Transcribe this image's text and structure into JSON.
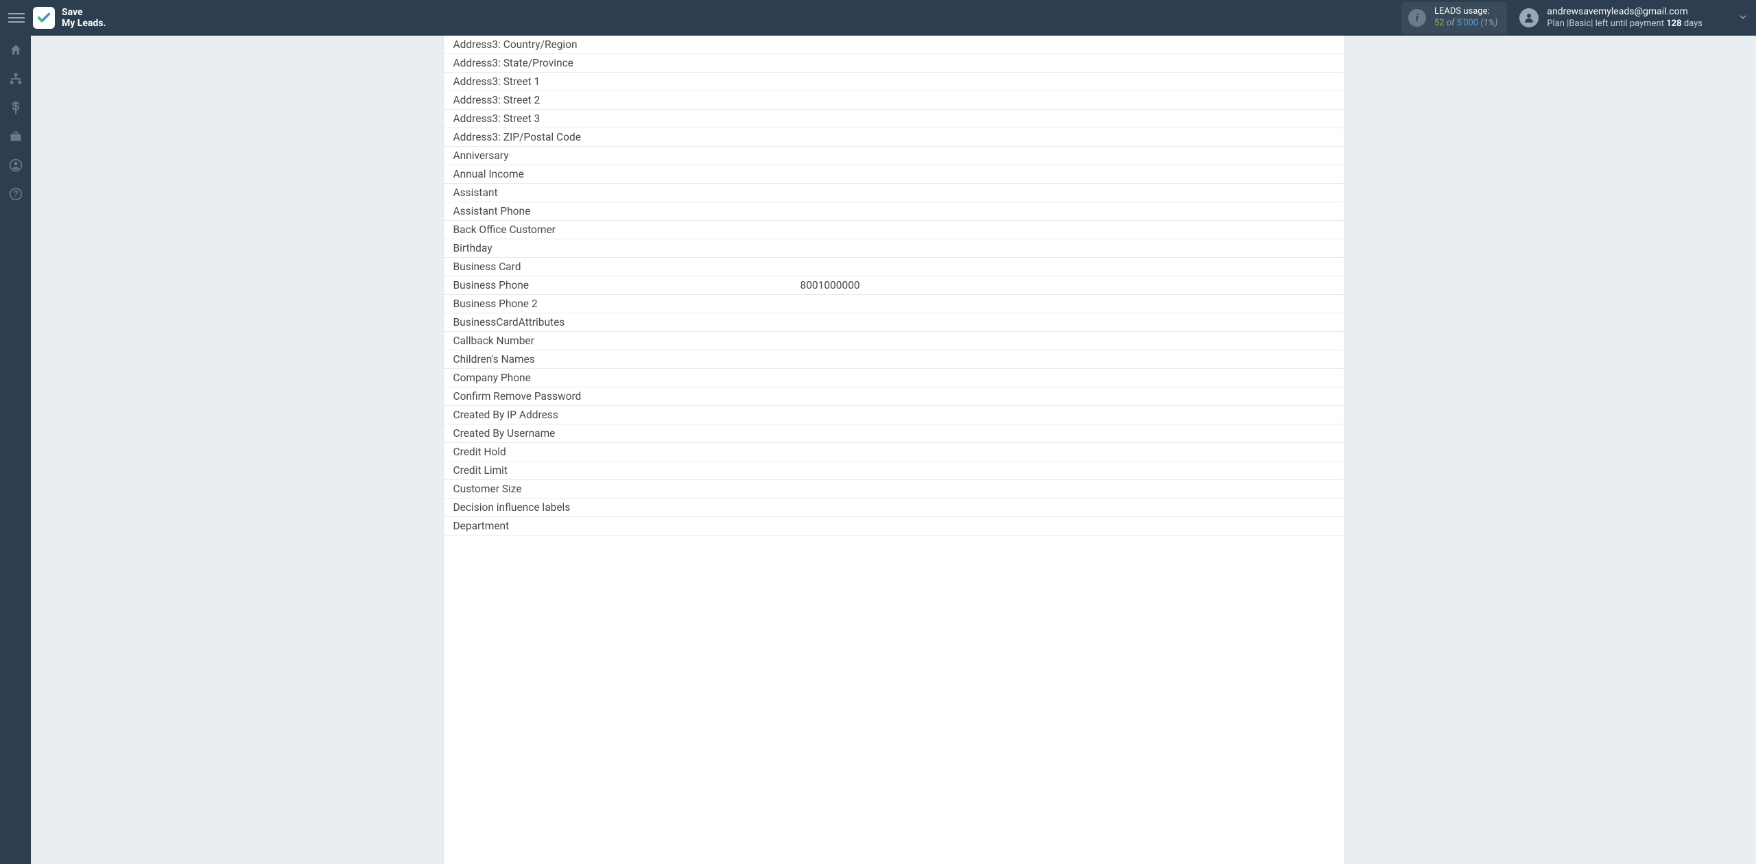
{
  "brand": {
    "line1": "Save",
    "line2": "My Leads."
  },
  "usage": {
    "label": "LEADS usage:",
    "count": "52",
    "of": "of",
    "total": "5'000",
    "pct": "(1%)"
  },
  "account": {
    "email": "andrewsavemyleads@gmail.com",
    "plan_prefix": "Plan |",
    "plan_name": "Basic",
    "plan_mid": "| left until payment ",
    "days": "128",
    "days_suffix": " days"
  },
  "sidebar": {
    "items": [
      {
        "name": "home"
      },
      {
        "name": "sitemap"
      },
      {
        "name": "dollar"
      },
      {
        "name": "briefcase"
      },
      {
        "name": "user"
      },
      {
        "name": "help"
      }
    ]
  },
  "fields": [
    {
      "label": "Address3: Country/Region",
      "value": ""
    },
    {
      "label": "Address3: State/Province",
      "value": ""
    },
    {
      "label": "Address3: Street 1",
      "value": ""
    },
    {
      "label": "Address3: Street 2",
      "value": ""
    },
    {
      "label": "Address3: Street 3",
      "value": ""
    },
    {
      "label": "Address3: ZIP/Postal Code",
      "value": ""
    },
    {
      "label": "Anniversary",
      "value": ""
    },
    {
      "label": "Annual Income",
      "value": ""
    },
    {
      "label": "Assistant",
      "value": ""
    },
    {
      "label": "Assistant Phone",
      "value": ""
    },
    {
      "label": "Back Office Customer",
      "value": ""
    },
    {
      "label": "Birthday",
      "value": ""
    },
    {
      "label": "Business Card",
      "value": ""
    },
    {
      "label": "Business Phone",
      "value": "8001000000"
    },
    {
      "label": "Business Phone 2",
      "value": ""
    },
    {
      "label": "BusinessCardAttributes",
      "value": ""
    },
    {
      "label": "Callback Number",
      "value": ""
    },
    {
      "label": "Children's Names",
      "value": ""
    },
    {
      "label": "Company Phone",
      "value": ""
    },
    {
      "label": "Confirm Remove Password",
      "value": ""
    },
    {
      "label": "Created By IP Address",
      "value": ""
    },
    {
      "label": "Created By Username",
      "value": ""
    },
    {
      "label": "Credit Hold",
      "value": ""
    },
    {
      "label": "Credit Limit",
      "value": ""
    },
    {
      "label": "Customer Size",
      "value": ""
    },
    {
      "label": "Decision influence labels",
      "value": ""
    },
    {
      "label": "Department",
      "value": ""
    }
  ]
}
